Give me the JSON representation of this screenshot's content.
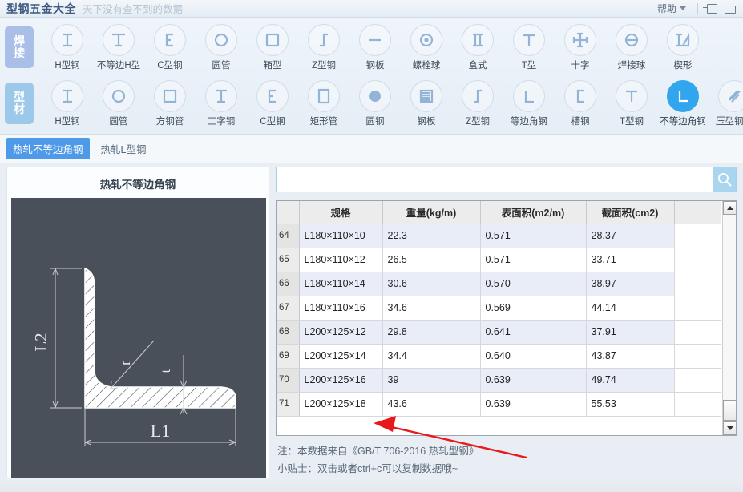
{
  "titlebar": {
    "app_title": "型钢五金大全",
    "subtitle": "天下没有查不到的数据",
    "help_label": "帮助",
    "pin_icon": "pin-icon",
    "minimize_icon": "minimize-icon",
    "caret_icon": "chevron-down-icon"
  },
  "ribbon": {
    "rows": [
      {
        "category": "焊接",
        "category_chars": [
          "焊",
          "接"
        ],
        "tools": [
          {
            "label": "H型钢",
            "icon": "h-beam-icon"
          },
          {
            "label": "不等边H型",
            "icon": "unequal-h-beam-icon"
          },
          {
            "label": "C型钢",
            "icon": "c-channel-icon"
          },
          {
            "label": "圆管",
            "icon": "round-pipe-icon"
          },
          {
            "label": "箱型",
            "icon": "box-section-icon"
          },
          {
            "label": "Z型钢",
            "icon": "z-section-icon"
          },
          {
            "label": "钢板",
            "icon": "steel-plate-icon"
          },
          {
            "label": "螺栓球",
            "icon": "bolt-ball-icon"
          },
          {
            "label": "盒式",
            "icon": "box-type-icon"
          },
          {
            "label": "T型",
            "icon": "t-section-icon"
          },
          {
            "label": "十字",
            "icon": "cross-section-icon"
          },
          {
            "label": "焊接球",
            "icon": "welded-ball-icon"
          },
          {
            "label": "楔形",
            "icon": "wedge-icon"
          }
        ]
      },
      {
        "category": "型材",
        "category_chars": [
          "型",
          "材"
        ],
        "tools": [
          {
            "label": "H型钢",
            "icon": "h-beam-icon"
          },
          {
            "label": "圆管",
            "icon": "round-pipe-icon"
          },
          {
            "label": "方钢管",
            "icon": "square-pipe-icon"
          },
          {
            "label": "工字钢",
            "icon": "i-beam-icon"
          },
          {
            "label": "C型钢",
            "icon": "c-channel-icon"
          },
          {
            "label": "矩形管",
            "icon": "rect-pipe-icon"
          },
          {
            "label": "圆钢",
            "icon": "round-bar-icon"
          },
          {
            "label": "钢板",
            "icon": "steel-plate-icon"
          },
          {
            "label": "Z型钢",
            "icon": "z-section-icon"
          },
          {
            "label": "等边角钢",
            "icon": "equal-angle-icon"
          },
          {
            "label": "槽钢",
            "icon": "channel-icon"
          },
          {
            "label": "T型钢",
            "icon": "t-steel-icon"
          },
          {
            "label": "不等边角钢",
            "icon": "unequal-angle-icon",
            "active": true
          },
          {
            "label": "压型钢板",
            "icon": "profiled-plate-icon"
          }
        ]
      }
    ]
  },
  "tabs": [
    {
      "label": "热轧不等边角钢",
      "active": true
    },
    {
      "label": "热轧L型钢",
      "active": false
    }
  ],
  "diagram": {
    "title": "热轧不等边角钢",
    "labels": {
      "l1": "L1",
      "l2": "L2",
      "r": "r",
      "t": "t"
    },
    "background_color": "#4a505a"
  },
  "search": {
    "value": "",
    "placeholder": "",
    "icon": "search-icon"
  },
  "table": {
    "headers": [
      "",
      "规格",
      "重量(kg/m)",
      "表面积(m2/m)",
      "截面积(cm2)",
      ""
    ],
    "rows": [
      {
        "idx": "64",
        "spec": "L180×110×10",
        "weight": "22.3",
        "surface": "0.571",
        "section": "28.37"
      },
      {
        "idx": "65",
        "spec": "L180×110×12",
        "weight": "26.5",
        "surface": "0.571",
        "section": "33.71"
      },
      {
        "idx": "66",
        "spec": "L180×110×14",
        "weight": "30.6",
        "surface": "0.570",
        "section": "38.97"
      },
      {
        "idx": "67",
        "spec": "L180×110×16",
        "weight": "34.6",
        "surface": "0.569",
        "section": "44.14"
      },
      {
        "idx": "68",
        "spec": "L200×125×12",
        "weight": "29.8",
        "surface": "0.641",
        "section": "37.91"
      },
      {
        "idx": "69",
        "spec": "L200×125×14",
        "weight": "34.4",
        "surface": "0.640",
        "section": "43.87"
      },
      {
        "idx": "70",
        "spec": "L200×125×16",
        "weight": "39",
        "surface": "0.639",
        "section": "49.74"
      },
      {
        "idx": "71",
        "spec": "L200×125×18",
        "weight": "43.6",
        "surface": "0.639",
        "section": "55.53"
      }
    ],
    "scrollbar": {
      "up_icon": "scroll-up-icon",
      "down_icon": "scroll-down-icon"
    }
  },
  "notes": {
    "source": "注：本数据来自《GB/T 706-2016  热轧型钢》",
    "tip": "小贴士：双击或者ctrl+c可以复制数据哦~"
  },
  "colors": {
    "accent": "#32a5ef",
    "tab_active": "#4f9ae8",
    "cat_weld": "#a9bfe8",
    "cat_shape": "#9cc9ea",
    "annotation": "#e8181c"
  }
}
